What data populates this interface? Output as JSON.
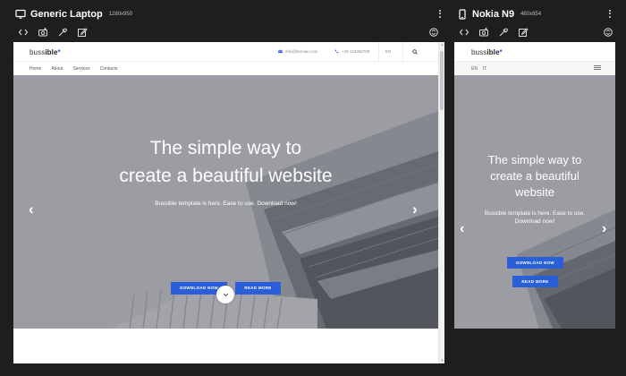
{
  "devices": [
    {
      "name": "Generic Laptop",
      "size": "1280x950"
    },
    {
      "name": "Nokia N9",
      "size": "480x854"
    }
  ],
  "site": {
    "logo_prefix": "buss",
    "logo_bold": "ible",
    "logo_dot": "*",
    "email": "info@domain.com",
    "phone": "+39 123456789",
    "lang": "EN",
    "lang_alt": "IT",
    "nav": [
      "Home",
      "About",
      "Services",
      "Contacts"
    ],
    "hero_title_line1": "The simple way to",
    "hero_title_line2": "create a beautiful website",
    "mobile_title_line1": "The simple way to",
    "mobile_title_line2": "create a beautiful",
    "mobile_title_line3": "website",
    "hero_subtitle": "Bussible template is here. Ease to use. Download now!",
    "mobile_sub_line1": "Bussible template is here. Ease to use.",
    "mobile_sub_line2": "Download now!",
    "download_label": "DOWNLOAD NOW",
    "readmore_label": "READ MORE",
    "prev": "‹",
    "next": "›"
  },
  "colors": {
    "accent": "#2b5fd9",
    "background": "#1e1e1e"
  },
  "icons": [
    "monitor-icon",
    "phone-icon",
    "code-icon",
    "camera-icon",
    "eyedropper-icon",
    "edit-icon",
    "rotate-icon",
    "kebab-menu-icon",
    "mail-icon",
    "phone-call-icon",
    "search-icon",
    "hamburger-icon",
    "chevron-down-icon"
  ]
}
